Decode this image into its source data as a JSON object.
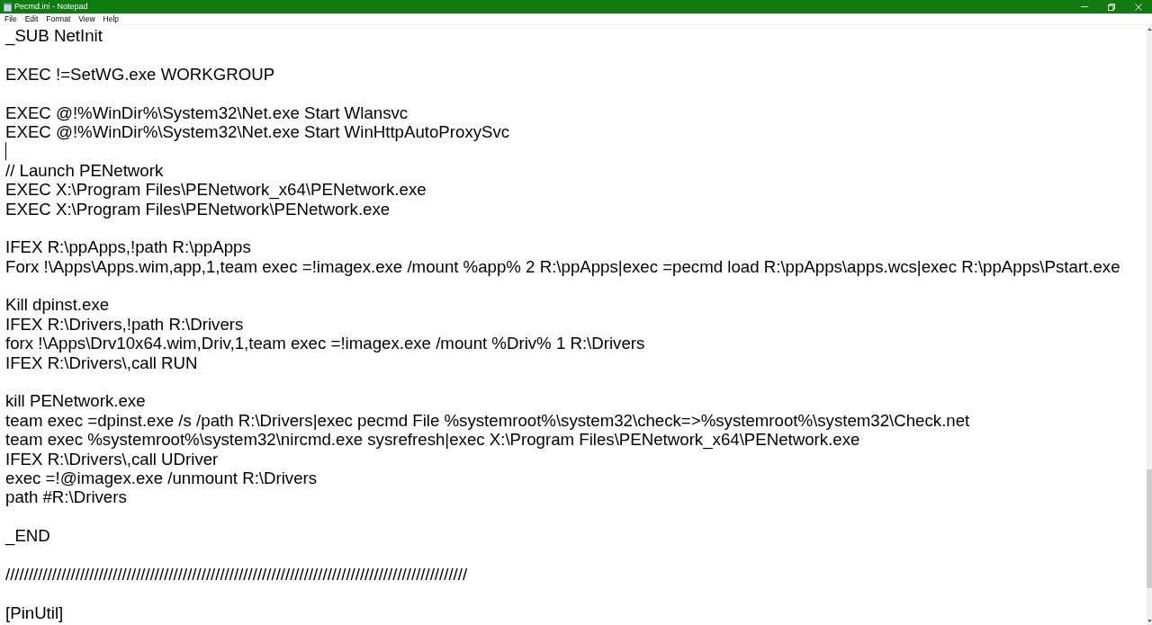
{
  "window": {
    "title": "Pecmd.ini - Notepad"
  },
  "menu": [
    "File",
    "Edit",
    "Format",
    "View",
    "Help"
  ],
  "document": {
    "blocks": [
      {
        "lines": [
          "_SUB NetInit"
        ],
        "caret_after": false
      },
      {
        "lines": [
          "EXEC !=SetWG.exe WORKGROUP"
        ],
        "caret_after": false
      },
      {
        "lines": [
          "EXEC @!%WinDir%\\System32\\Net.exe Start Wlansvc",
          "EXEC @!%WinDir%\\System32\\Net.exe Start WinHttpAutoProxySvc"
        ],
        "caret_after": true
      },
      {
        "lines": [
          "// Launch PENetwork",
          "EXEC X:\\Program Files\\PENetwork_x64\\PENetwork.exe",
          "EXEC X:\\Program Files\\PENetwork\\PENetwork.exe"
        ],
        "caret_after": false
      },
      {
        "lines": [
          "IFEX R:\\ppApps,!path R:\\ppApps",
          "Forx !\\Apps\\Apps.wim,app,1,team exec =!imagex.exe /mount %app% 2 R:\\ppApps|exec =pecmd load R:\\ppApps\\apps.wcs|exec R:\\ppApps\\Pstart.exe"
        ],
        "caret_after": false
      },
      {
        "lines": [
          "Kill dpinst.exe",
          "IFEX R:\\Drivers,!path R:\\Drivers",
          "forx !\\Apps\\Drv10x64.wim,Driv,1,team exec =!imagex.exe /mount %Driv% 1 R:\\Drivers",
          "IFEX R:\\Drivers\\,call RUN"
        ],
        "caret_after": false
      },
      {
        "lines": [
          "kill PENetwork.exe",
          "team exec =dpinst.exe /s /path R:\\Drivers|exec pecmd File %systemroot%\\system32\\check=>%systemroot%\\system32\\Check.net",
          "team exec %systemroot%\\system32\\nircmd.exe sysrefresh|exec X:\\Program Files\\PENetwork_x64\\PENetwork.exe",
          "IFEX R:\\Drivers\\,call UDriver",
          "exec =!@imagex.exe /unmount R:\\Drivers",
          "path #R:\\Drivers"
        ],
        "caret_after": false
      },
      {
        "lines": [
          "_END"
        ],
        "caret_after": false
      },
      {
        "lines": [
          "///////////////////////////////////////////////////////////////////////////////////////////////////"
        ],
        "caret_after": false
      },
      {
        "lines": [
          "[PinUtil]"
        ],
        "caret_after": false
      }
    ]
  }
}
